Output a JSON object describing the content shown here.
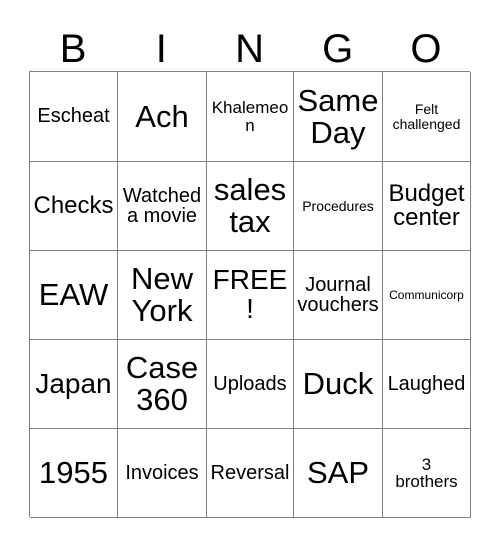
{
  "card": {
    "title": "Bingo Card",
    "header_letters": [
      "B",
      "I",
      "N",
      "G",
      "O"
    ],
    "grid_size": "5x5",
    "free_space_label": "FREE!",
    "border_color": "#808080",
    "text_color": "#000000",
    "background_color": "#ffffff",
    "rows": [
      [
        {
          "text": "Escheat",
          "size": "md"
        },
        {
          "text": "Ach",
          "size": "xxl"
        },
        {
          "text": "Khalemeon",
          "size": "sm"
        },
        {
          "text": "Same\nDay",
          "size": "xxl"
        },
        {
          "text": "Felt\nchallenged",
          "size": "xs"
        }
      ],
      [
        {
          "text": "Checks",
          "size": "lg"
        },
        {
          "text": "Watched\na movie",
          "size": "md"
        },
        {
          "text": "sales\ntax",
          "size": "xxl"
        },
        {
          "text": "Procedures",
          "size": "xs"
        },
        {
          "text": "Budget\ncenter",
          "size": "lg"
        }
      ],
      [
        {
          "text": "EAW",
          "size": "xxl"
        },
        {
          "text": "New\nYork",
          "size": "xxl"
        },
        {
          "text": "FREE!",
          "size": "xl"
        },
        {
          "text": "Journal\nvouchers",
          "size": "md"
        },
        {
          "text": "Communicorp",
          "size": "xxs"
        }
      ],
      [
        {
          "text": "Japan",
          "size": "xl"
        },
        {
          "text": "Case\n360",
          "size": "xxl"
        },
        {
          "text": "Uploads",
          "size": "md"
        },
        {
          "text": "Duck",
          "size": "xxl"
        },
        {
          "text": "Laughed",
          "size": "md"
        }
      ],
      [
        {
          "text": "1955",
          "size": "xxl"
        },
        {
          "text": "Invoices",
          "size": "md"
        },
        {
          "text": "Reversal",
          "size": "md"
        },
        {
          "text": "SAP",
          "size": "xxl"
        },
        {
          "text": "3\nbrothers",
          "size": "sm"
        }
      ]
    ]
  }
}
